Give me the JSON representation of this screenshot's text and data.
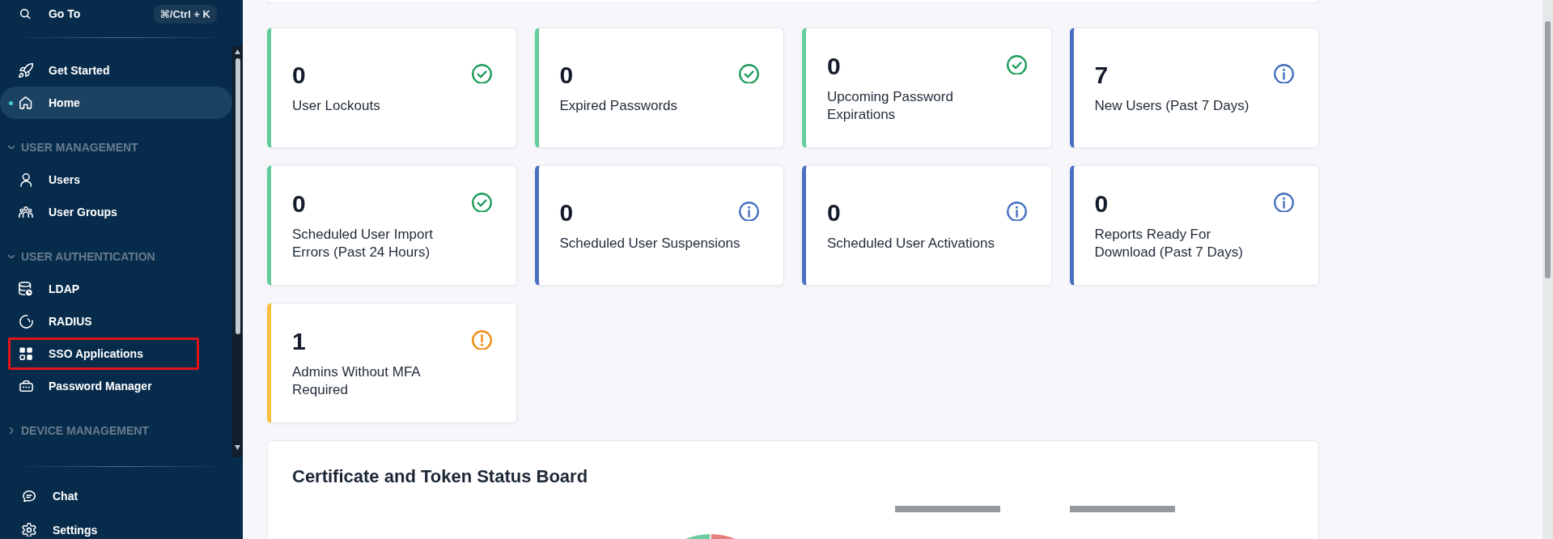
{
  "sidebar": {
    "goto": {
      "label": "Go To",
      "shortcut": "⌘/Ctrl + K"
    },
    "items": [
      {
        "label": "Get Started",
        "selected": false,
        "annotated": false
      },
      {
        "label": "Home",
        "selected": true,
        "annotated": false
      }
    ],
    "sections": [
      {
        "title": "USER MANAGEMENT",
        "expanded": true,
        "items": [
          {
            "label": "Users",
            "selected": false,
            "annotated": false
          },
          {
            "label": "User Groups",
            "selected": false,
            "annotated": false
          }
        ]
      },
      {
        "title": "USER AUTHENTICATION",
        "expanded": true,
        "items": [
          {
            "label": "LDAP",
            "selected": false,
            "annotated": false
          },
          {
            "label": "RADIUS",
            "selected": false,
            "annotated": false
          },
          {
            "label": "SSO Applications",
            "selected": false,
            "annotated": true
          },
          {
            "label": "Password Manager",
            "selected": false,
            "annotated": false
          }
        ]
      },
      {
        "title": "DEVICE MANAGEMENT",
        "expanded": false
      }
    ],
    "bottom_items": [
      {
        "label": "Chat",
        "selected": false,
        "annotated": false
      },
      {
        "label": "Settings",
        "selected": false,
        "annotated": false
      }
    ]
  },
  "cards": [
    {
      "value": "0",
      "label": "User Lockouts",
      "kind": "ok"
    },
    {
      "value": "0",
      "label": "Expired Passwords",
      "kind": "ok"
    },
    {
      "value": "0",
      "label": "Upcoming Password\nExpirations",
      "kind": "ok"
    },
    {
      "value": "7",
      "label": "New Users (Past 7 Days)",
      "kind": "info"
    },
    {
      "value": "0",
      "label": "Scheduled User Import\nErrors (Past 24 Hours)",
      "kind": "ok"
    },
    {
      "value": "0",
      "label": "Scheduled User Suspensions",
      "kind": "info"
    },
    {
      "value": "0",
      "label": "Scheduled User Activations",
      "kind": "info"
    },
    {
      "value": "0",
      "label": "Reports Ready For\nDownload (Past 7 Days)",
      "kind": "info"
    },
    {
      "value": "1",
      "label": "Admins Without MFA\nRequired",
      "kind": "warning"
    }
  ],
  "status_board": {
    "title": "Certificate and Token Status Board"
  }
}
